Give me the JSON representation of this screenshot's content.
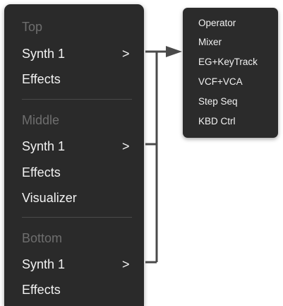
{
  "menu": {
    "sections": [
      {
        "header": "Top",
        "items": [
          {
            "label": "Synth 1",
            "submenu": true
          },
          {
            "label": "Effects"
          }
        ]
      },
      {
        "header": "Middle",
        "items": [
          {
            "label": "Synth 1",
            "submenu": true
          },
          {
            "label": "Effects"
          },
          {
            "label": "Visualizer"
          }
        ]
      },
      {
        "header": "Bottom",
        "items": [
          {
            "label": "Synth 1",
            "submenu": true
          },
          {
            "label": "Effects"
          }
        ]
      }
    ],
    "chevron_glyph": ">"
  },
  "submenu": {
    "items": [
      "Operator",
      "Mixer",
      "EG+KeyTrack",
      "VCF+VCA",
      "Step Seq",
      "KBD Ctrl"
    ]
  },
  "colors": {
    "menu_background": "#2a2a2a",
    "header_text": "#6e6e6e",
    "item_text": "#f2f2f2",
    "connector": "#4a4a4a"
  }
}
